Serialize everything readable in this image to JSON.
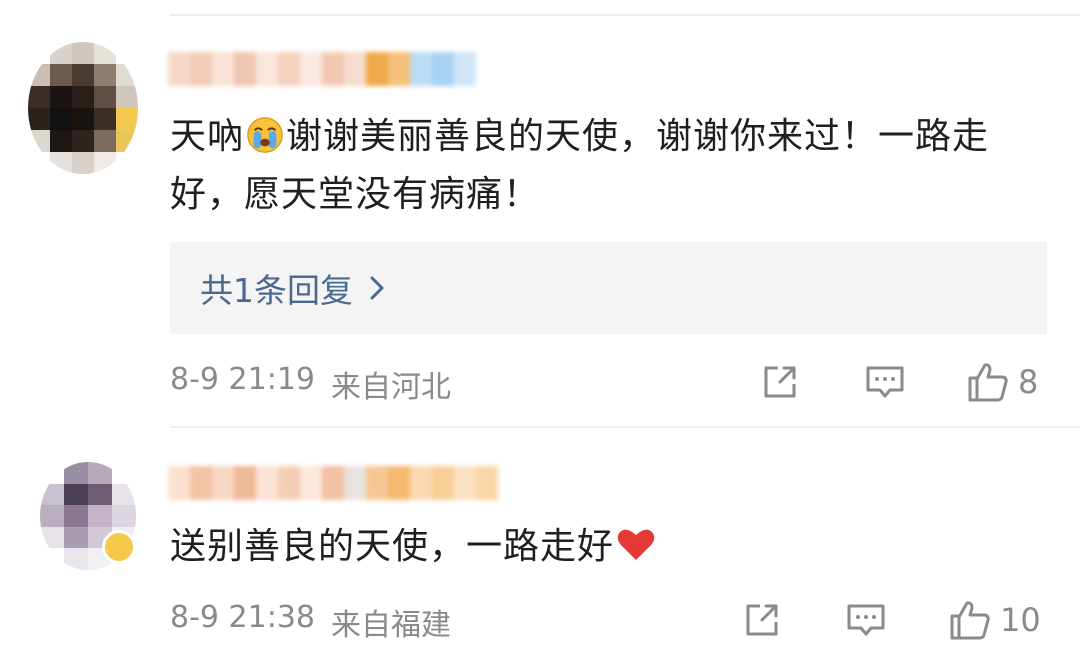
{
  "comments": [
    {
      "text_a": "天吶",
      "emoji": "loudly-crying-face-icon",
      "text_b": "谢谢美丽善良的天使，谢谢你来过！一路走好，愿天堂没有病痛！",
      "reply_link": "共1条回复",
      "time": "8-9 21:19",
      "location": "来自河北",
      "likes": "8"
    },
    {
      "text_a": "送别善良的天使，一路走好",
      "emoji": "red-heart-icon",
      "time": "8-9 21:38",
      "location": "来自福建",
      "likes": "10"
    }
  ],
  "colors": {
    "link": "#4a6b91",
    "meta": "#8a8a8a",
    "reply_bg": "#f4f4f4",
    "heart": "#e53935"
  }
}
